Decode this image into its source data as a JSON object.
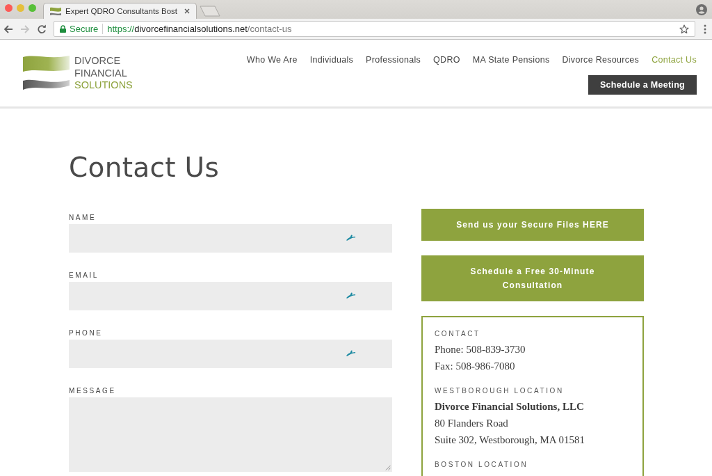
{
  "browser": {
    "tabs": [
      {
        "title": "Expert QDRO Consultants Bost",
        "selected": true
      }
    ],
    "nav_buttons": [
      {
        "kind": "back",
        "disabled": false
      },
      {
        "kind": "forward",
        "disabled": true
      },
      {
        "kind": "reload",
        "disabled": false
      }
    ],
    "address_bar": {
      "secure_label": "Secure",
      "url": {
        "scheme": "https://",
        "host": "divorcefinancialsolutions.net",
        "path": "/contact-us"
      }
    }
  },
  "site_header": {
    "logo": {
      "lines": [
        {
          "text": "DIVORCE",
          "accent": false
        },
        {
          "text": "FINANCIAL",
          "accent": false
        },
        {
          "text": "SOLUTIONS",
          "accent": true
        }
      ]
    },
    "nav": [
      {
        "label": "Who We Are",
        "selected": false
      },
      {
        "label": "Individuals",
        "selected": false
      },
      {
        "label": "Professionals",
        "selected": false
      },
      {
        "label": "QDRO",
        "selected": false
      },
      {
        "label": "MA State Pensions",
        "selected": false
      },
      {
        "label": "Divorce Resources",
        "selected": false
      },
      {
        "label": "Contact Us",
        "selected": true
      }
    ],
    "cta_button": "Schedule a Meeting"
  },
  "page": {
    "title": "Contact Us"
  },
  "form": {
    "fields": [
      {
        "label": "NAME",
        "kind": "text"
      },
      {
        "label": "EMAIL",
        "kind": "text"
      },
      {
        "label": "PHONE",
        "kind": "text"
      },
      {
        "label": "MESSAGE",
        "kind": "textarea"
      }
    ]
  },
  "sidebar": {
    "buttons": [
      "Send us your Secure Files HERE",
      "Schedule a Free 30-Minute Consultation"
    ],
    "info": {
      "sections": [
        {
          "heading": "CONTACT",
          "lines": [
            {
              "text": "Phone: 508-839-3730",
              "bold": false
            },
            {
              "text": "Fax: 508-986-7080",
              "bold": false
            }
          ]
        },
        {
          "heading": "WESTBOROUGH LOCATION",
          "lines": [
            {
              "text": "Divorce Financial Solutions, LLC",
              "bold": true
            },
            {
              "text": "80 Flanders Road",
              "bold": false
            },
            {
              "text": "Suite 302, Westborough, MA 01581",
              "bold": false
            }
          ]
        },
        {
          "heading": "BOSTON LOCATION"
        }
      ]
    }
  }
}
